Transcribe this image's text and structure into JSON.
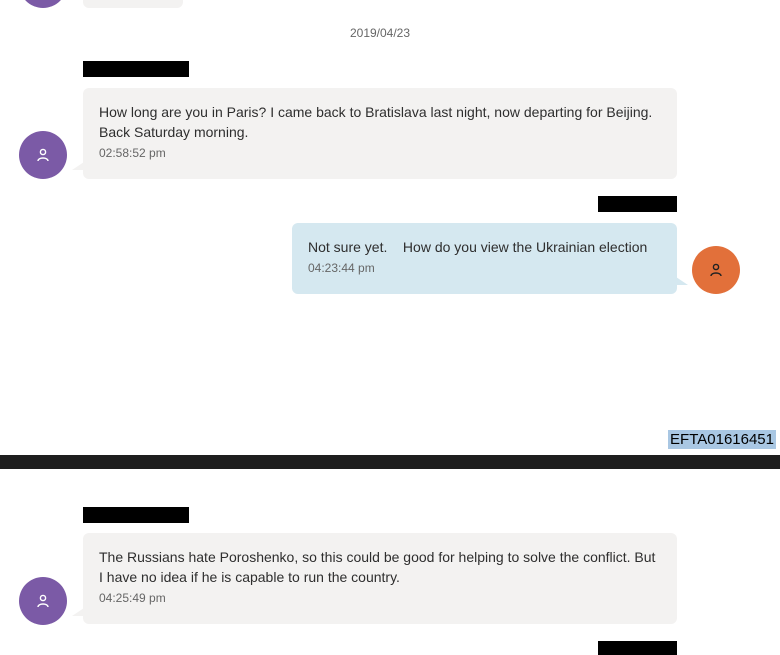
{
  "date_separator": "2019/04/23",
  "messages": [
    {
      "text": "How long are you in Paris? I came back to Bratislava last night, now departing for Beijing. Back Saturday morning.",
      "time": "02:58:52 pm",
      "side": "left"
    },
    {
      "text": "Not sure yet.    How do you view the Ukrainian election",
      "time": "04:23:44 pm",
      "side": "right"
    },
    {
      "text": "The Russians hate Poroshenko, so this could be good for helping to solve the conflict. But I have no idea if he is capable to run the country.",
      "time": "04:25:49 pm",
      "side": "left"
    }
  ],
  "doc_id": "EFTA01616451",
  "colors": {
    "avatar_left": "#7b5aa6",
    "avatar_right": "#e2703a",
    "bubble_left": "#f3f2f1",
    "bubble_right": "#d5e8f0"
  },
  "icons": {
    "avatar_icon": "person-icon"
  }
}
